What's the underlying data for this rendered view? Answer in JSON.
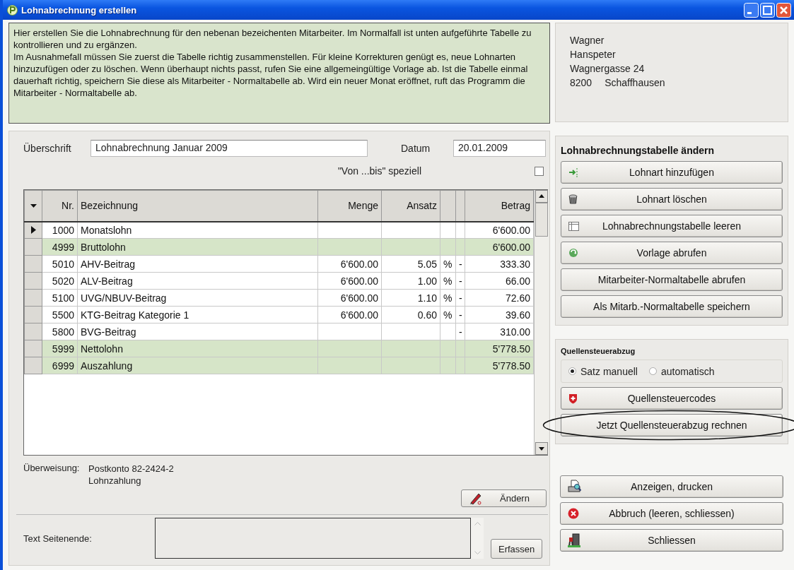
{
  "window": {
    "title": "Lohnabrechnung erstellen"
  },
  "info_text": [
    "Hier erstellen Sie die Lohnabrechnung für den nebenan bezeichenten Mitarbeiter. Im Normalfall ist unten aufgeführte Tabelle zu kontrollieren und zu ergänzen.",
    "Im Ausnahmefall müssen Sie zuerst die Tabelle richtig zusammenstellen. Für kleine Korrekturen genügt es, neue Lohnarten hinzuzufügen oder zu löschen. Wenn überhaupt nichts passt, rufen Sie eine allgemeingültige Vorlage ab. Ist die Tabelle einmal dauerhaft richtig, speichern Sie diese als Mitarbeiter - Normaltabelle ab. Wird ein neuer Monat eröffnet, ruft das Programm die Mitarbeiter - Normaltabelle ab."
  ],
  "employee": {
    "lines": [
      "Wagner",
      "Hanspeter",
      "Wagnergasse 24"
    ],
    "postal_code": "8200",
    "city": "Schaffhausen"
  },
  "heading_field": {
    "label": "Überschrift",
    "value": "Lohnabrechnung Januar 2009"
  },
  "date_field": {
    "label": "Datum",
    "value": "20.01.2009"
  },
  "special_range": {
    "label": "\"Von ...bis\" speziell",
    "checked": false
  },
  "table": {
    "columns": [
      "Nr.",
      "Bezeichnung",
      "Menge",
      "Ansatz",
      "Betrag"
    ],
    "rows": [
      {
        "kind": "line",
        "selected": true,
        "nr": "1000",
        "name": "Monatslohn",
        "amount": "6'600.00"
      },
      {
        "kind": "total",
        "selected": false,
        "nr": "4999",
        "name": "Bruttolohn",
        "amount": "6'600.00"
      },
      {
        "kind": "line",
        "selected": false,
        "nr": "5010",
        "name": "AHV-Beitrag",
        "quantity": "6'600.00",
        "rate": "5.05",
        "unit": "%",
        "sign": "-",
        "amount": "333.30"
      },
      {
        "kind": "line",
        "selected": false,
        "nr": "5020",
        "name": "ALV-Beitrag",
        "quantity": "6'600.00",
        "rate": "1.00",
        "unit": "%",
        "sign": "-",
        "amount": "66.00"
      },
      {
        "kind": "line",
        "selected": false,
        "nr": "5100",
        "name": "UVG/NBUV-Beitrag",
        "quantity": "6'600.00",
        "rate": "1.10",
        "unit": "%",
        "sign": "-",
        "amount": "72.60"
      },
      {
        "kind": "line",
        "selected": false,
        "nr": "5500",
        "name": "KTG-Beitrag Kategorie 1",
        "quantity": "6'600.00",
        "rate": "0.60",
        "unit": "%",
        "sign": "-",
        "amount": "39.60"
      },
      {
        "kind": "line",
        "selected": false,
        "nr": "5800",
        "name": "BVG-Beitrag",
        "sign": "-",
        "amount": "310.00"
      },
      {
        "kind": "total",
        "selected": false,
        "nr": "5999",
        "name": "Nettolohn",
        "amount": "5'778.50"
      },
      {
        "kind": "total",
        "selected": false,
        "nr": "6999",
        "name": "Auszahlung",
        "amount": "5'778.50"
      }
    ]
  },
  "transfer": {
    "label": "Überweisung:",
    "lines": [
      "Postkonto 82-2424-2",
      "Lohnzahlung"
    ],
    "button": "Ändern"
  },
  "page_end_text": {
    "label": "Text Seitenende:",
    "button": "Erfassen"
  },
  "table_edit": {
    "title": "Lohnabrechnungstabelle ändern",
    "buttons": [
      {
        "label": "Lohnart hinzufügen"
      },
      {
        "label": "Lohnart löschen"
      },
      {
        "label": "Lohnabrechnungstabelle leeren"
      },
      {
        "label": "Vorlage abrufen"
      },
      {
        "label": "Mitarbeiter-Normaltabelle abrufen"
      },
      {
        "label": "Als Mitarb.-Normaltabelle speichern"
      }
    ]
  },
  "withholding_tax": {
    "title": "Quellensteuerabzug",
    "modes": [
      {
        "label": "Satz manuell",
        "selected": true
      },
      {
        "label": "automatisch",
        "selected": false
      }
    ],
    "buttons": [
      {
        "label": "Quellensteuercodes",
        "circled": false
      },
      {
        "label": "Jetzt Quellensteuerabzug rechnen",
        "circled": true
      }
    ]
  },
  "actions": [
    {
      "label": "Anzeigen, drucken"
    },
    {
      "label": "Abbruch (leeren, schliessen)"
    },
    {
      "label": "Schliessen"
    }
  ]
}
